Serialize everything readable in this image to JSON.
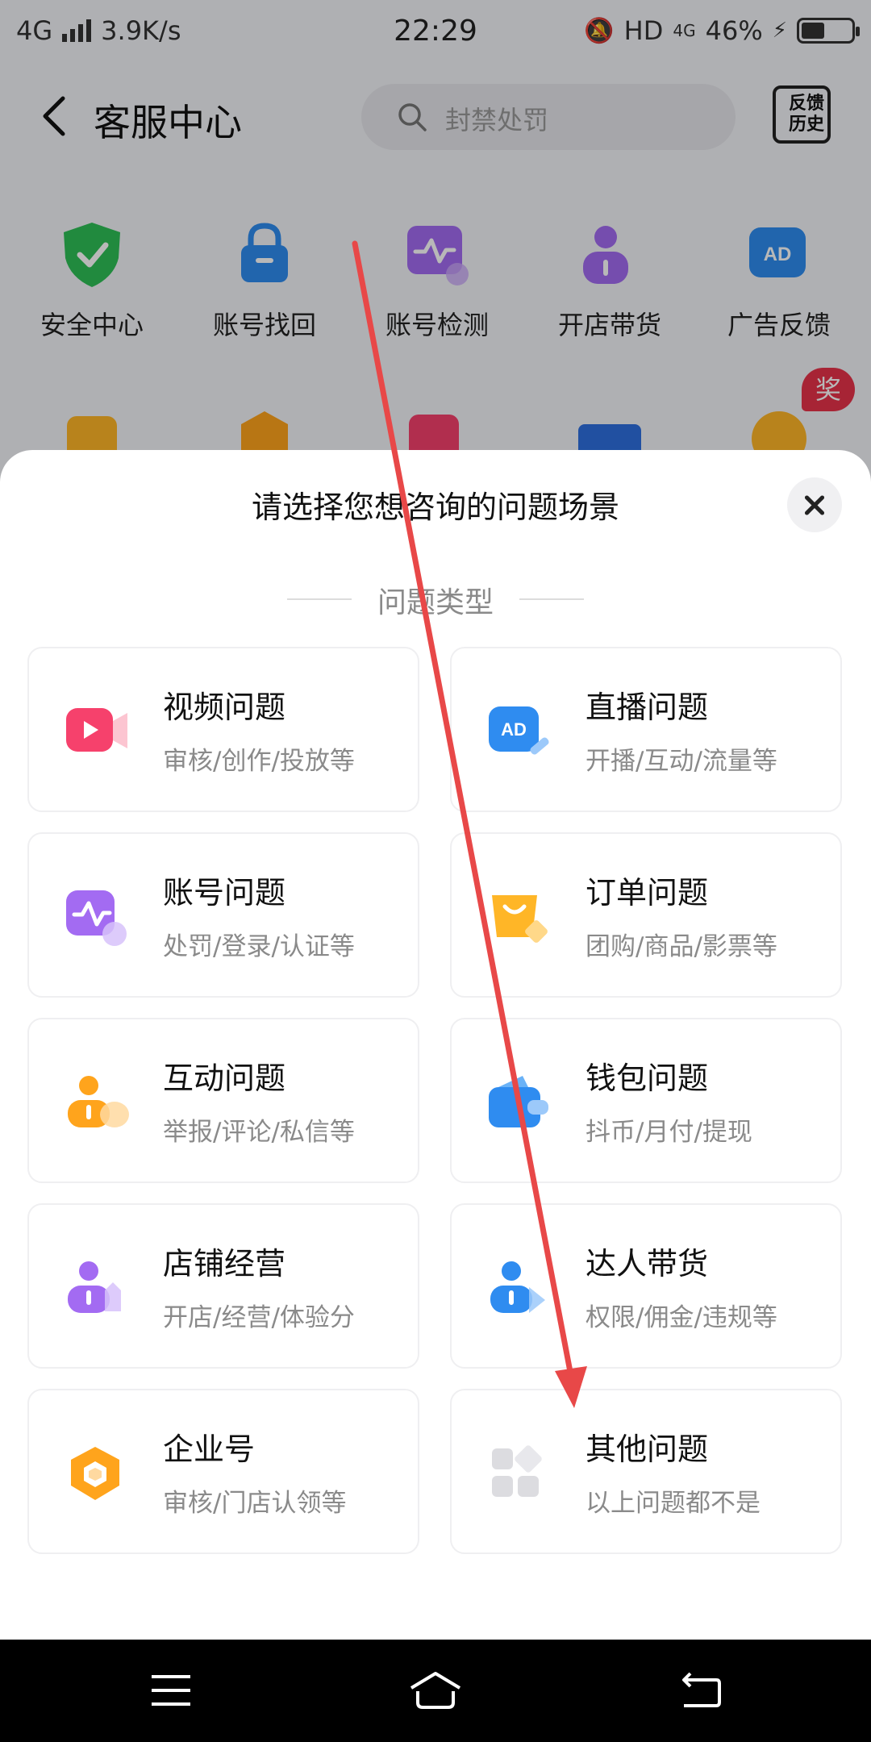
{
  "status": {
    "network": "4G",
    "speed": "3.9K/s",
    "time": "22:29",
    "hd": "HD",
    "net2": "4G",
    "battery": "46%",
    "battery_level": 0.46
  },
  "nav": {
    "title": "客服中心",
    "search_placeholder": "封禁处罚",
    "history_line1": "反馈",
    "history_line2": "历史"
  },
  "shortcuts": [
    {
      "label": "安全中心",
      "icon": "shield-icon"
    },
    {
      "label": "账号找回",
      "icon": "lock-icon"
    },
    {
      "label": "账号检测",
      "icon": "pulse-icon"
    },
    {
      "label": "开店带货",
      "icon": "person-icon"
    },
    {
      "label": "广告反馈",
      "icon": "ad-icon"
    }
  ],
  "reward_badge": "奖",
  "sheet": {
    "title": "请选择您想咨询的问题场景",
    "section": "问题类型",
    "cards": [
      {
        "title": "视频问题",
        "subtitle": "审核/创作/投放等",
        "icon": "video-icon",
        "color": "#f6416c"
      },
      {
        "title": "直播问题",
        "subtitle": "开播/互动/流量等",
        "icon": "ad-icon",
        "color": "#2f8cf0"
      },
      {
        "title": "账号问题",
        "subtitle": "处罚/登录/认证等",
        "icon": "pulse-icon",
        "color": "#a36bf2"
      },
      {
        "title": "订单问题",
        "subtitle": "团购/商品/影票等",
        "icon": "bag-icon",
        "color": "#ffb627"
      },
      {
        "title": "互动问题",
        "subtitle": "举报/评论/私信等",
        "icon": "person-icon",
        "color": "#ffa41c"
      },
      {
        "title": "钱包问题",
        "subtitle": "抖币/月付/提现",
        "icon": "wallet-icon",
        "color": "#2f8cf0"
      },
      {
        "title": "店铺经营",
        "subtitle": "开店/经营/体验分",
        "icon": "person-icon",
        "color": "#a36bf2"
      },
      {
        "title": "达人带货",
        "subtitle": "权限/佣金/违规等",
        "icon": "person-icon",
        "color": "#2f8cf0"
      },
      {
        "title": "企业号",
        "subtitle": "审核/门店认领等",
        "icon": "cube-icon",
        "color": "#ffa41c"
      },
      {
        "title": "其他问题",
        "subtitle": "以上问题都不是",
        "icon": "grid-icon",
        "color": "#cfcfd4"
      }
    ]
  },
  "sys_nav": {
    "menu": "menu-icon",
    "home": "home-icon",
    "back": "back-icon"
  }
}
